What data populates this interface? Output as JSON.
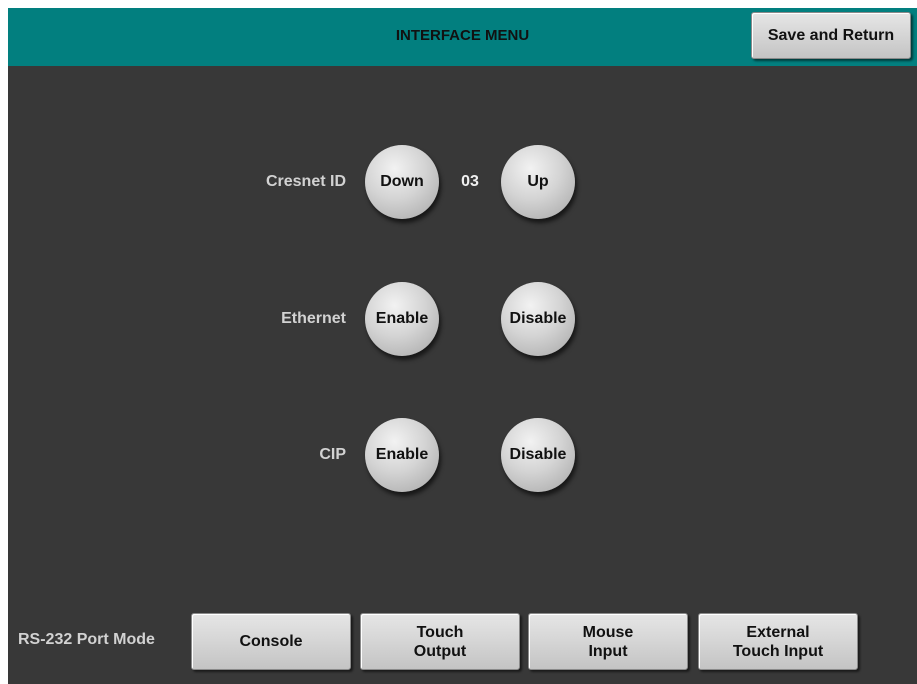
{
  "header": {
    "title": "INTERFACE MENU",
    "save_return_label": "Save and Return"
  },
  "cresnet": {
    "label": "Cresnet ID",
    "down_label": "Down",
    "value": "03",
    "up_label": "Up"
  },
  "ethernet": {
    "label": "Ethernet",
    "enable_label": "Enable",
    "disable_label": "Disable"
  },
  "cip": {
    "label": "CIP",
    "enable_label": "Enable",
    "disable_label": "Disable"
  },
  "rs232": {
    "label": "RS-232 Port Mode",
    "options": [
      "Console",
      "Touch\nOutput",
      "Mouse\nInput",
      "External\nTouch Input"
    ]
  },
  "colors": {
    "header": "#027f7f",
    "background": "#383838",
    "button_face": "#d4d4d4",
    "label_text": "#d2d2d2"
  }
}
